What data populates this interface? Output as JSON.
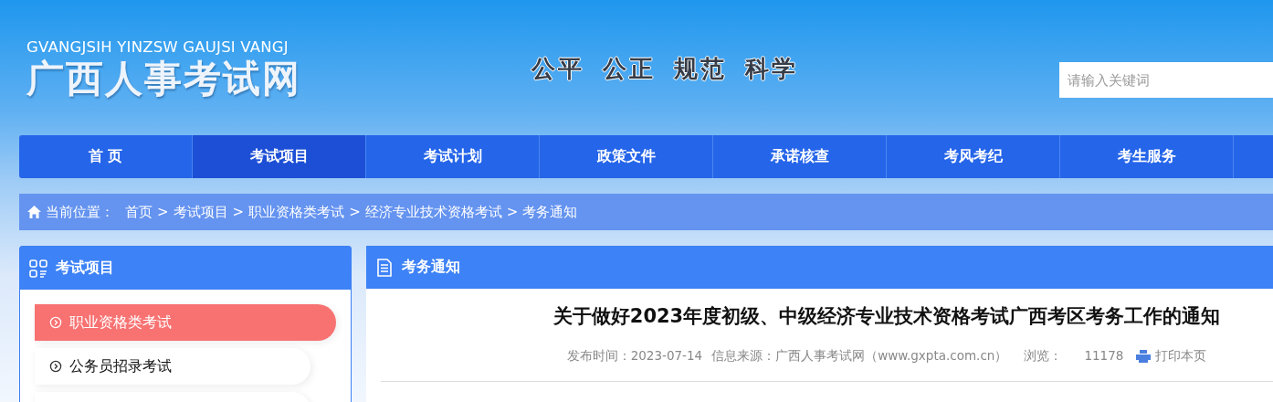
{
  "header": {
    "logo_pinyin": "GVANGJSIH YINZSW GAUJSI VANGJ",
    "logo_title": "广西人事考试网",
    "slogan": [
      "公平",
      "公正",
      "规范",
      "科学"
    ],
    "search": {
      "placeholder": "请输入关键词"
    }
  },
  "nav": [
    {
      "label": "首 页",
      "selected": false
    },
    {
      "label": "考试项目",
      "selected": true
    },
    {
      "label": "考试计划",
      "selected": false
    },
    {
      "label": "政策文件",
      "selected": false
    },
    {
      "label": "承诺核查",
      "selected": false
    },
    {
      "label": "考风考纪",
      "selected": false
    },
    {
      "label": "考生服务",
      "selected": false
    }
  ],
  "breadcrumb": {
    "label": "当前位置：",
    "separator": ">",
    "items": [
      "首页",
      "考试项目",
      "职业资格类考试",
      "经济专业技术资格考试",
      "考务通知"
    ]
  },
  "sidebar": {
    "title": "考试项目",
    "items": [
      {
        "label": "职业资格类考试",
        "selected": true
      },
      {
        "label": "公务员招录考试",
        "selected": false
      }
    ]
  },
  "article": {
    "section": "考务通知",
    "title": "关于做好2023年度初级、中级经济专业技术资格考试广西考区考务工作的通知",
    "meta": [
      {
        "label": "发布时间：",
        "value": "2023-07-14"
      },
      {
        "label": "信息来源：",
        "value": "广西人事考试网（www.gxpta.com.cn）"
      },
      {
        "label": "浏览：",
        "value": "11178"
      }
    ],
    "print": "打印本页"
  }
}
